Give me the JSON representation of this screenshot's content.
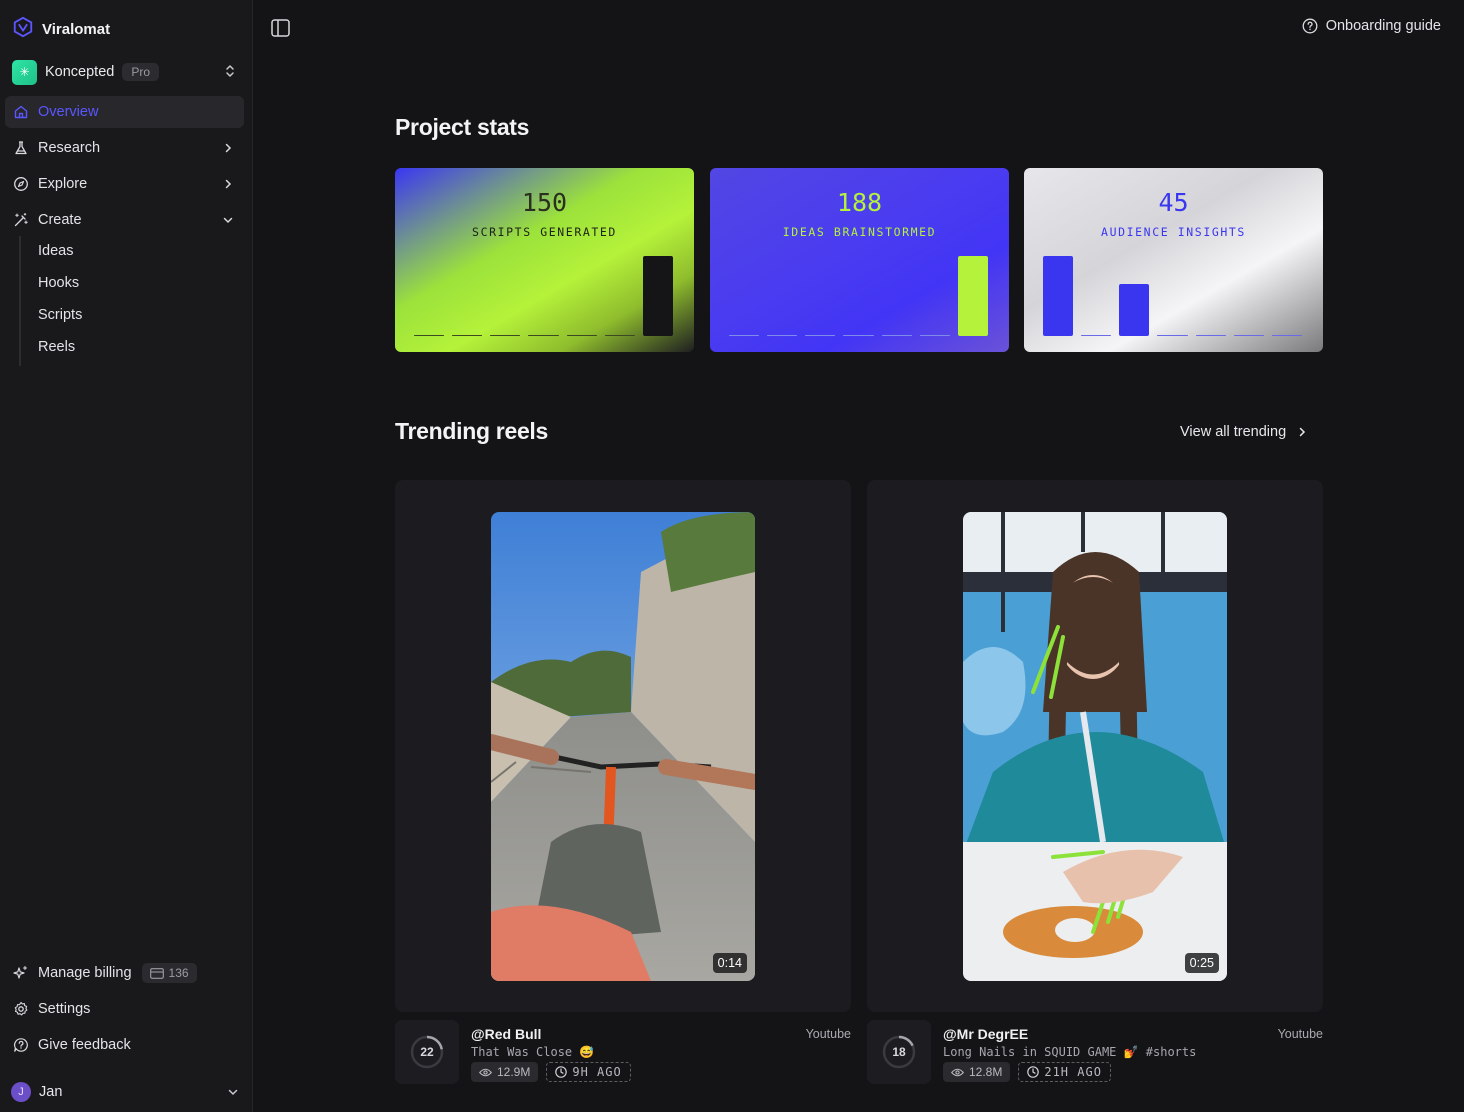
{
  "app": {
    "name": "Viralomat"
  },
  "workspace": {
    "name": "Koncepted",
    "plan": "Pro"
  },
  "nav": {
    "overview": "Overview",
    "research": "Research",
    "explore": "Explore",
    "create": "Create",
    "create_items": [
      "Ideas",
      "Hooks",
      "Scripts",
      "Reels"
    ]
  },
  "footer": {
    "billing": "Manage billing",
    "credits": "136",
    "settings": "Settings",
    "feedback": "Give feedback",
    "user_initial": "J",
    "user_name": "Jan"
  },
  "topbar": {
    "guide": "Onboarding guide"
  },
  "stats": {
    "title": "Project stats",
    "cards": [
      {
        "value": "150",
        "label": "SCRIPTS GENERATED",
        "bars": [
          0,
          0,
          0,
          0,
          0,
          0,
          1
        ],
        "value_color": "#2b2f1f",
        "label_color": "#1e2214",
        "bar_color": "#151517",
        "flat_color": "#3b4a22"
      },
      {
        "value": "188",
        "label": "IDEAS BRAINSTORMED",
        "bars": [
          0,
          0,
          0,
          0,
          0,
          0,
          1
        ],
        "value_color": "#b4f23b",
        "label_color": "#b4f23b",
        "bar_color": "#b4f23b",
        "flat_color": "#7f8be8"
      },
      {
        "value": "45",
        "label": "AUDIENCE INSIGHTS",
        "bars": [
          1,
          0,
          0.65,
          0,
          0,
          0,
          0
        ],
        "value_color": "#3b36ef",
        "label_color": "#3b36ef",
        "bar_color": "#3a36ef",
        "flat_color": "#6a6ae8"
      }
    ]
  },
  "trending": {
    "title": "Trending reels",
    "view_all": "View all trending",
    "reels": [
      {
        "duration": "0:14",
        "score": "22",
        "score_fraction": 0.22,
        "handle": "@Red Bull",
        "source": "Youtube",
        "caption": "That Was Close 😅",
        "views": "12.9M",
        "age": "9H AGO"
      },
      {
        "duration": "0:25",
        "score": "18",
        "score_fraction": 0.18,
        "handle": "@Mr DegrEE",
        "source": "Youtube",
        "caption": "Long Nails in SQUID GAME 💅 #shorts",
        "views": "12.8M",
        "age": "21H AGO"
      }
    ]
  }
}
